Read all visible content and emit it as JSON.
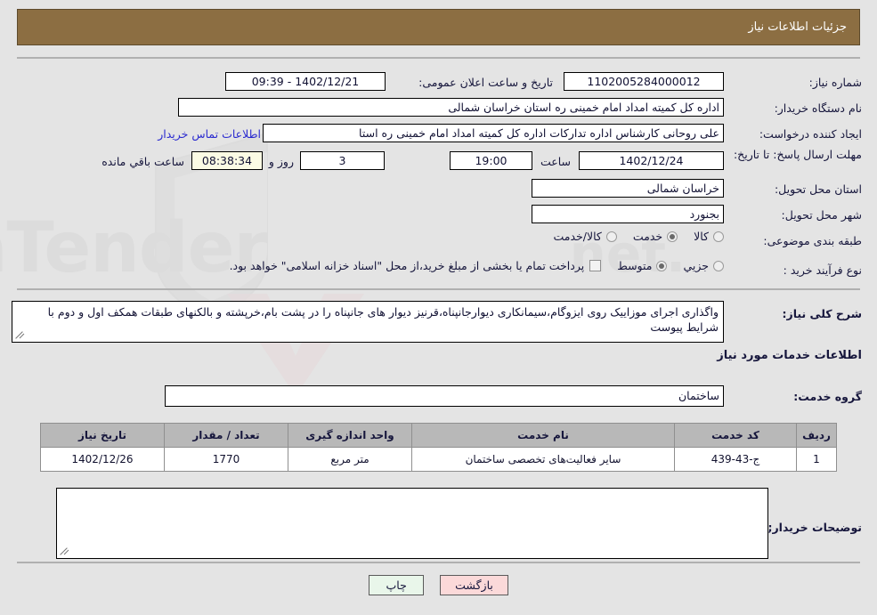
{
  "header": {
    "title": "جزئیات اطلاعات نیاز"
  },
  "form": {
    "need_number_label": "شماره نیاز:",
    "need_number_value": "1102005284000012",
    "announce_datetime_label": "تاریخ و ساعت اعلان عمومی:",
    "announce_datetime_value": "1402/12/21 - 09:39",
    "buyer_org_label": "نام دستگاه خریدار:",
    "buyer_org_value": "اداره کل کمیته امداد امام خمینی  ره  استان خراسان شمالی",
    "creator_label": "ایجاد کننده درخواست:",
    "creator_value": "علی روحانی کارشناس اداره تدارکات اداره کل کمیته امداد امام خمینی  ره  استا",
    "contact_link": "اطلاعات تماس خریدار",
    "deadline_label": "مهلت ارسال پاسخ: تا تاریخ:",
    "deadline_date": "1402/12/24",
    "deadline_time_label": "ساعت",
    "deadline_time": "19:00",
    "days_left": "3",
    "days_word": "روز و",
    "countdown": "08:38:34",
    "countdown_suffix": "ساعت باقي مانده",
    "province_label": "استان محل تحویل:",
    "province_value": "خراسان شمالی",
    "city_label": "شهر محل تحویل:",
    "city_value": "بجنورد",
    "category_label": "طبقه بندی موضوعی:",
    "category_options": [
      {
        "label": "کالا",
        "checked": false
      },
      {
        "label": "خدمت",
        "checked": true
      },
      {
        "label": "کالا/خدمت",
        "checked": false
      }
    ],
    "process_label": "نوع فرآیند خرید :",
    "process_options": [
      {
        "label": "جزیي",
        "checked": false
      },
      {
        "label": "متوسط",
        "checked": true
      }
    ],
    "treasury_checkbox_label": "پرداخت تمام یا بخشی از مبلغ خرید،از محل \"اسناد خزانه اسلامی\" خواهد بود.",
    "treasury_checked": false
  },
  "description": {
    "label": "شرح کلی نیاز:",
    "value": "واگذاری اجرای موزاییک روی ایزوگام،سیمانکاری دیوارجانپناه،قرنیز دیوار های جانپناه را در پشت بام،خرپشته و بالکنهای طبقات همکف اول و دوم با شرایط پیوست"
  },
  "services": {
    "heading": "اطلاعات خدمات مورد نیاز",
    "group_label": "گروه خدمت:",
    "group_value": "ساختمان",
    "columns": [
      "ردیف",
      "کد خدمت",
      "نام خدمت",
      "واحد اندازه گیری",
      "تعداد / مقدار",
      "تاریخ نیاز"
    ],
    "rows": [
      {
        "index": "1",
        "code": "ج-43-439",
        "name": "سایر فعالیت‌های تخصصی ساختمان",
        "unit": "متر مربع",
        "quantity": "1770",
        "need_date": "1402/12/26"
      }
    ]
  },
  "buyer_notes": {
    "label": "توضیحات خریدار;",
    "value": ""
  },
  "buttons": {
    "print": "چاپ",
    "back": "بازگشت"
  },
  "watermark": {
    "text": "AriaTender.net"
  },
  "colors": {
    "header_bg": "#8c6e42",
    "page_bg": "#e4e4e4",
    "table_header_bg": "#b8b8b8",
    "link": "#2b2bcf",
    "countdown_bg": "#fbfbe4",
    "btn_print_bg": "#e9f6ea",
    "btn_back_bg": "#fbd9d9"
  }
}
